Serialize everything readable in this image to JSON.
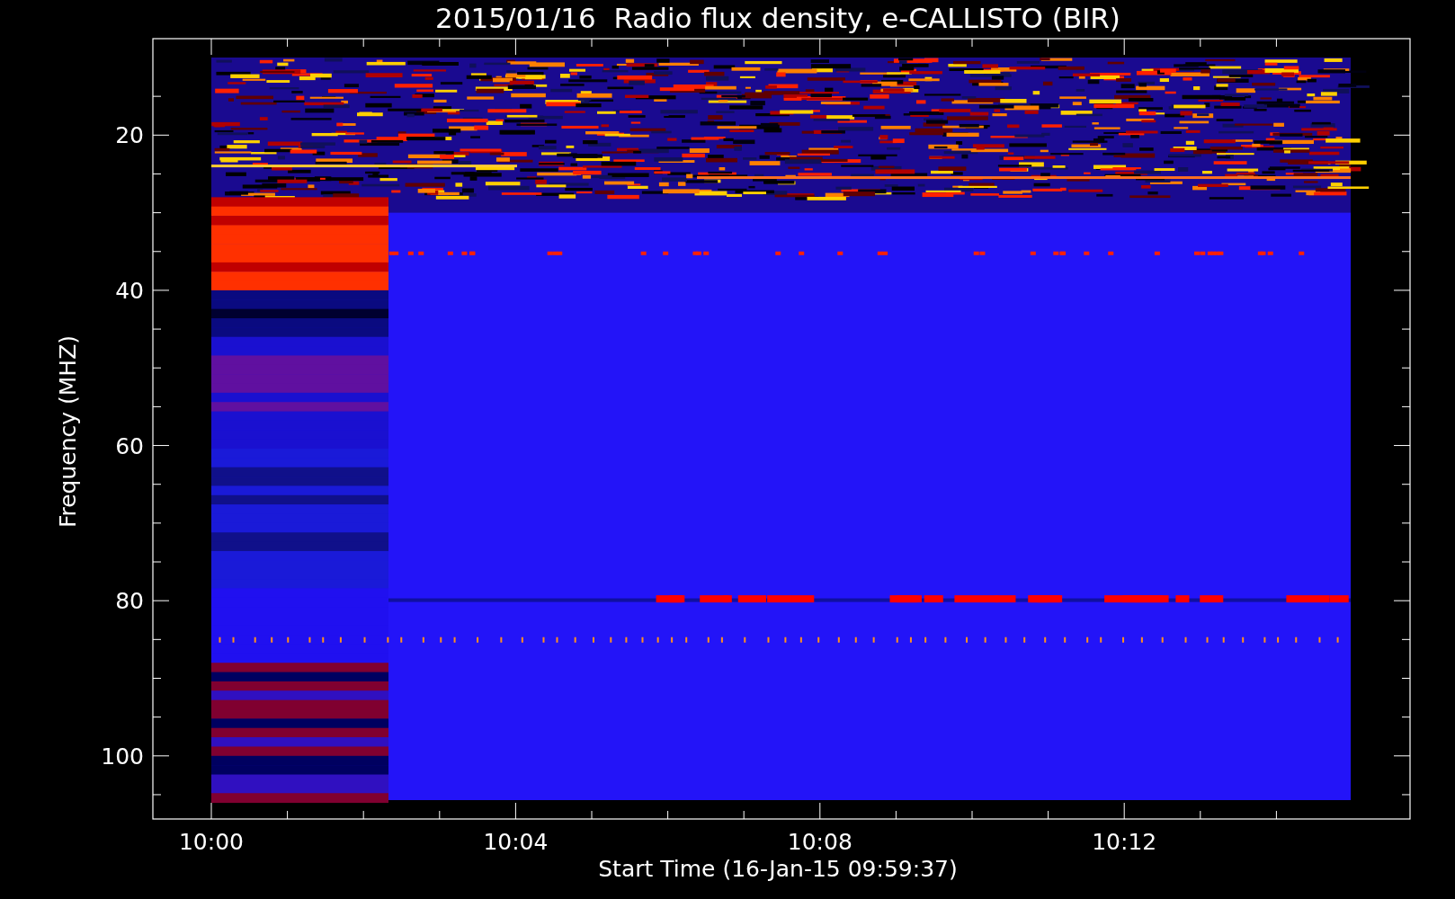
{
  "title": "2015/01/16  Radio flux density, e-CALLISTO (BIR)",
  "y_axis": {
    "label": "Frequency (MHZ)",
    "ticks": [
      "20",
      "40",
      "60",
      "80",
      "100"
    ]
  },
  "x_axis": {
    "label": "Start Time (16-Jan-15 09:59:37)",
    "ticks": [
      "10:00",
      "10:04",
      "10:08",
      "10:12"
    ]
  }
}
